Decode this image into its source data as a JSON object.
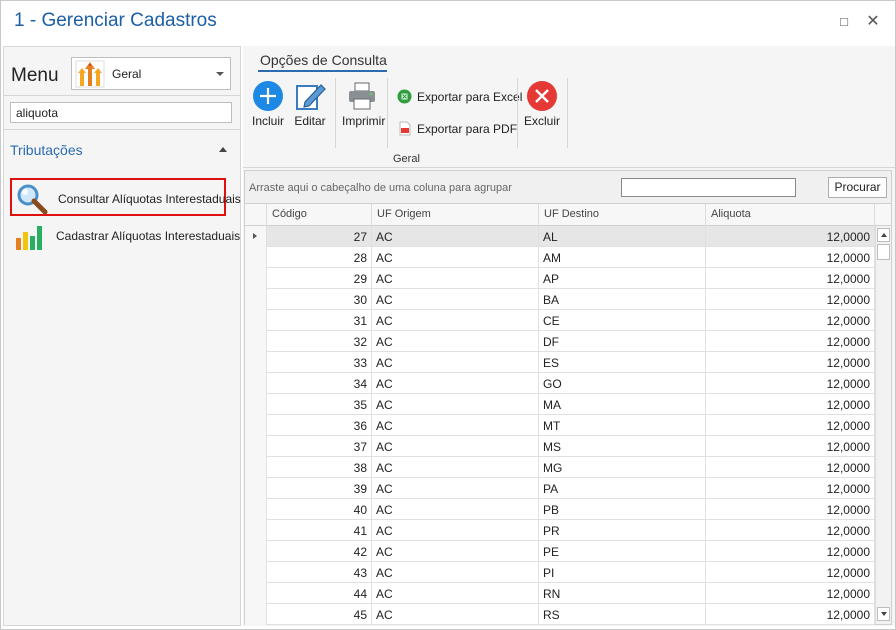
{
  "window": {
    "title": "1 - Gerenciar Cadastros",
    "maximize_glyph": "□",
    "close_glyph": "✕"
  },
  "menu": {
    "label": "Menu",
    "selected_module": "Geral",
    "search_value": "aliquota",
    "group_title": "Tributações",
    "items": [
      {
        "label": "Consultar Alíquotas Interestaduais",
        "icon": "magnifier-icon",
        "highlighted": true
      },
      {
        "label": "Cadastrar Alíquotas Interestaduais",
        "icon": "bar-chart-icon",
        "highlighted": false
      }
    ]
  },
  "ribbon": {
    "tab": "Opções de Consulta",
    "group_caption": "Geral",
    "buttons": {
      "incluir": "Incluir",
      "editar": "Editar",
      "imprimir": "Imprimir",
      "exportar_excel": "Exportar para Excel",
      "exportar_pdf": "Exportar para PDF",
      "excluir": "Excluir"
    },
    "colors": {
      "accent": "#2b6cb0",
      "add": "#1e88e5",
      "delete": "#e53935",
      "excel": "#2e9e3e",
      "pdf": "#e53935"
    }
  },
  "grid": {
    "group_hint": "Arraste aqui o cabeçalho de uma coluna para agrupar",
    "search_value": "",
    "search_button": "Procurar",
    "columns": [
      "Código",
      "UF Origem",
      "UF Destino",
      "Aliquota"
    ],
    "rows": [
      {
        "codigo": "27",
        "origem": "AC",
        "destino": "AL",
        "aliquota": "12,0000"
      },
      {
        "codigo": "28",
        "origem": "AC",
        "destino": "AM",
        "aliquota": "12,0000"
      },
      {
        "codigo": "29",
        "origem": "AC",
        "destino": "AP",
        "aliquota": "12,0000"
      },
      {
        "codigo": "30",
        "origem": "AC",
        "destino": "BA",
        "aliquota": "12,0000"
      },
      {
        "codigo": "31",
        "origem": "AC",
        "destino": "CE",
        "aliquota": "12,0000"
      },
      {
        "codigo": "32",
        "origem": "AC",
        "destino": "DF",
        "aliquota": "12,0000"
      },
      {
        "codigo": "33",
        "origem": "AC",
        "destino": "ES",
        "aliquota": "12,0000"
      },
      {
        "codigo": "34",
        "origem": "AC",
        "destino": "GO",
        "aliquota": "12,0000"
      },
      {
        "codigo": "35",
        "origem": "AC",
        "destino": "MA",
        "aliquota": "12,0000"
      },
      {
        "codigo": "36",
        "origem": "AC",
        "destino": "MT",
        "aliquota": "12,0000"
      },
      {
        "codigo": "37",
        "origem": "AC",
        "destino": "MS",
        "aliquota": "12,0000"
      },
      {
        "codigo": "38",
        "origem": "AC",
        "destino": "MG",
        "aliquota": "12,0000"
      },
      {
        "codigo": "39",
        "origem": "AC",
        "destino": "PA",
        "aliquota": "12,0000"
      },
      {
        "codigo": "40",
        "origem": "AC",
        "destino": "PB",
        "aliquota": "12,0000"
      },
      {
        "codigo": "41",
        "origem": "AC",
        "destino": "PR",
        "aliquota": "12,0000"
      },
      {
        "codigo": "42",
        "origem": "AC",
        "destino": "PE",
        "aliquota": "12,0000"
      },
      {
        "codigo": "43",
        "origem": "AC",
        "destino": "PI",
        "aliquota": "12,0000"
      },
      {
        "codigo": "44",
        "origem": "AC",
        "destino": "RN",
        "aliquota": "12,0000"
      },
      {
        "codigo": "45",
        "origem": "AC",
        "destino": "RS",
        "aliquota": "12,0000"
      }
    ]
  }
}
